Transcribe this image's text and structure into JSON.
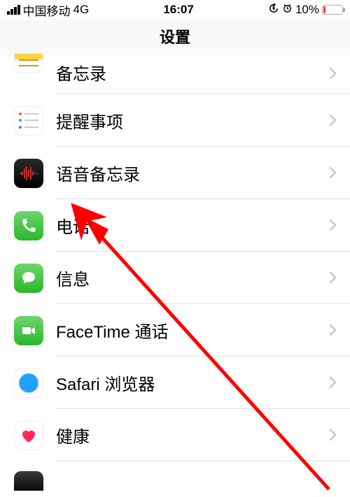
{
  "status": {
    "carrier": "中国移动",
    "network": "4G",
    "time": "16:07",
    "battery_text": "10%"
  },
  "nav": {
    "title": "设置"
  },
  "rows": {
    "notes": {
      "label": "备忘录",
      "icon": "notes-icon"
    },
    "reminders": {
      "label": "提醒事项",
      "icon": "reminders-icon"
    },
    "voicememo": {
      "label": "语音备忘录",
      "icon": "voice-memos-icon"
    },
    "phone": {
      "label": "电话",
      "icon": "phone-icon"
    },
    "messages": {
      "label": "信息",
      "icon": "messages-icon"
    },
    "facetime": {
      "label": "FaceTime 通话",
      "icon": "facetime-icon"
    },
    "safari": {
      "label": "Safari 浏览器",
      "icon": "safari-icon"
    },
    "health": {
      "label": "健康",
      "icon": "health-icon"
    }
  }
}
